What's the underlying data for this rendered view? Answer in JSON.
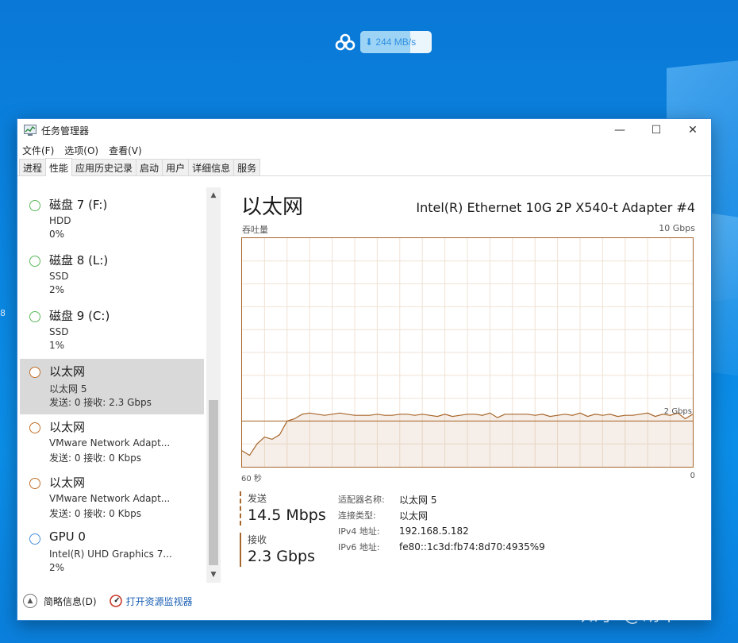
{
  "download_widget": {
    "speed": "⬇ 244 MB/s",
    "fill_fraction": 0.7
  },
  "desktop_edge_text": "8",
  "window": {
    "title": "任务管理器",
    "controls": {
      "minimize": "—",
      "maximize": "☐",
      "close": "✕"
    }
  },
  "menu": [
    "文件(F)",
    "选项(O)",
    "查看(V)"
  ],
  "tabs": [
    {
      "label": "进程",
      "active": false
    },
    {
      "label": "性能",
      "active": true
    },
    {
      "label": "应用历史记录",
      "active": false
    },
    {
      "label": "启动",
      "active": false
    },
    {
      "label": "用户",
      "active": false
    },
    {
      "label": "详细信息",
      "active": false
    },
    {
      "label": "服务",
      "active": false
    }
  ],
  "sidebar": {
    "items": [
      {
        "name": "磁盘 7 (F:)",
        "sub": "HDD",
        "value": "0%",
        "color": "#5cb85c",
        "selected": false
      },
      {
        "name": "磁盘 8 (L:)",
        "sub": "SSD",
        "value": "2%",
        "color": "#5cb85c",
        "selected": false
      },
      {
        "name": "磁盘 9 (C:)",
        "sub": "SSD",
        "value": "1%",
        "color": "#5cb85c",
        "selected": false
      },
      {
        "name": "以太网",
        "sub": "以太网 5",
        "value": "发送: 0 接收: 2.3 Gbps",
        "color": "#c0702c",
        "selected": true
      },
      {
        "name": "以太网",
        "sub": "VMware Network Adapt...",
        "value": "发送: 0 接收: 0 Kbps",
        "color": "#c0702c",
        "selected": false
      },
      {
        "name": "以太网",
        "sub": "VMware Network Adapt...",
        "value": "发送: 0 接收: 0 Kbps",
        "color": "#c0702c",
        "selected": false
      },
      {
        "name": "GPU 0",
        "sub": "Intel(R) UHD Graphics 7...",
        "value": "2%",
        "color": "#4a90d9",
        "selected": false
      }
    ]
  },
  "main": {
    "title": "以太网",
    "adapter": "Intel(R) Ethernet 10G 2P X540-t Adapter #4",
    "throughput_label": "吞吐量",
    "max_label": "10 Gbps",
    "line_label": "2 Gbps",
    "x_left": "60 秒",
    "x_right": "0",
    "send_label": "发送",
    "send_value": "14.5 Mbps",
    "recv_label": "接收",
    "recv_value": "2.3 Gbps",
    "info": [
      {
        "key": "适配器名称:",
        "value": "以太网 5"
      },
      {
        "key": "连接类型:",
        "value": "以太网"
      },
      {
        "key": "IPv4 地址:",
        "value": "192.168.5.182"
      },
      {
        "key": "IPv6 地址:",
        "value": "fe80::1c3d:fb74:8d70:4935%9"
      }
    ]
  },
  "chart_data": {
    "type": "area",
    "title": "吞吐量",
    "xlabel": "",
    "ylabel": "",
    "x_range_seconds": [
      60,
      0
    ],
    "ylim_gbps": [
      0,
      10
    ],
    "grid": true,
    "series": [
      {
        "name": "接收",
        "color": "#a7662b",
        "values_gbps": [
          0.7,
          0.5,
          1.0,
          1.3,
          1.2,
          1.4,
          2.0,
          2.1,
          2.3,
          2.35,
          2.3,
          2.25,
          2.3,
          2.35,
          2.3,
          2.25,
          2.25,
          2.25,
          2.3,
          2.25,
          2.25,
          2.3,
          2.3,
          2.25,
          2.3,
          2.25,
          2.2,
          2.3,
          2.2,
          2.25,
          2.3,
          2.3,
          2.25,
          2.35,
          2.15,
          2.3,
          2.3,
          2.3,
          2.3,
          2.25,
          2.3,
          2.2,
          2.25,
          2.3,
          2.25,
          2.35,
          2.2,
          2.3,
          2.25,
          2.3,
          2.2,
          2.25,
          2.25,
          2.3,
          2.35,
          2.2,
          2.3,
          2.25,
          2.35,
          2.1,
          2.3
        ]
      }
    ],
    "reference_line_gbps": 2.0
  },
  "footer": {
    "brief": "简略信息(D)",
    "monitor_link": "打开资源监视器"
  },
  "watermark": "知乎 @胡十一"
}
